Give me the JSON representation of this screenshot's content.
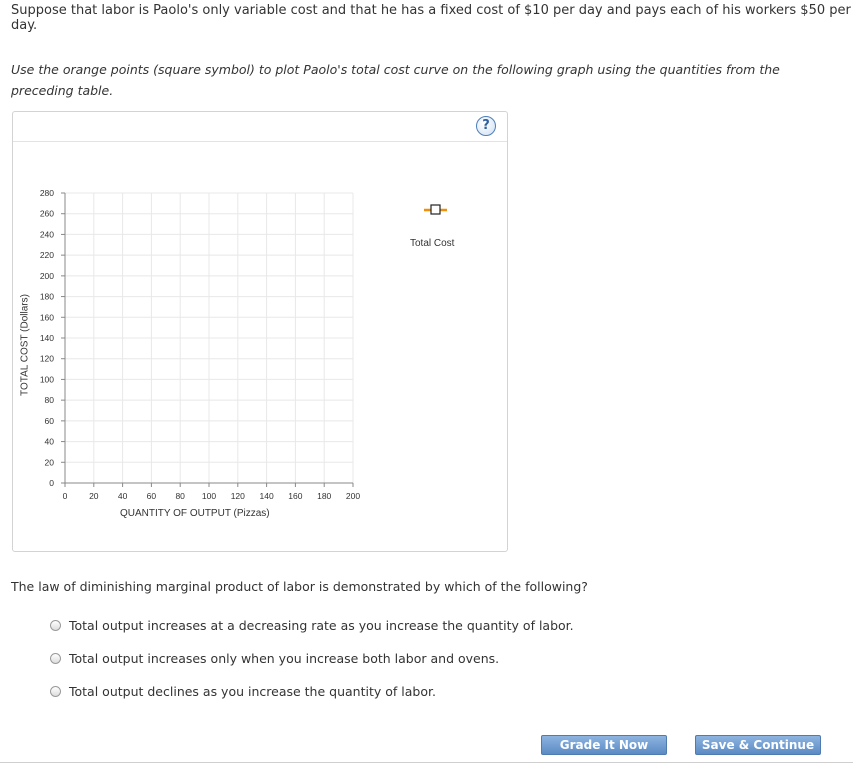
{
  "intro_text": "Suppose that labor is Paolo's only variable cost and that he has a fixed cost of $10 per day and pays each of his workers $50 per day.",
  "instruction_text": "Use the orange points (square symbol) to plot Paolo's total cost curve on the following graph using the quantities from the preceding table.",
  "help_icon": {
    "glyph": "?",
    "icon": "question-mark-circle"
  },
  "chart_data": {
    "type": "scatter",
    "xlabel": "QUANTITY OF OUTPUT (Pizzas)",
    "ylabel": "TOTAL COST (Dollars)",
    "xlim": [
      0,
      200
    ],
    "ylim": [
      0,
      280
    ],
    "x_ticks": [
      0,
      20,
      40,
      60,
      80,
      100,
      120,
      140,
      160,
      180,
      200
    ],
    "y_ticks": [
      0,
      20,
      40,
      60,
      80,
      100,
      120,
      140,
      160,
      180,
      200,
      220,
      240,
      260,
      280
    ],
    "grid": true,
    "legend_position": "right",
    "series": [
      {
        "name": "Total Cost",
        "marker": "square",
        "color": "#f0900a",
        "x": [],
        "y": []
      }
    ]
  },
  "question_text": "The law of diminishing marginal product of labor is demonstrated by which of the following?",
  "options": [
    {
      "label": "Total output increases at a decreasing rate as you increase the quantity of labor."
    },
    {
      "label": "Total output increases only when you increase both labor and ovens."
    },
    {
      "label": "Total output declines as you increase the quantity of labor."
    }
  ],
  "buttons": {
    "grade": "Grade It Now",
    "save": "Save & Continue"
  },
  "colors": {
    "button_blue": "#5b8ac4",
    "marker_orange": "#f0900a",
    "grid": "#e8e8e8"
  }
}
